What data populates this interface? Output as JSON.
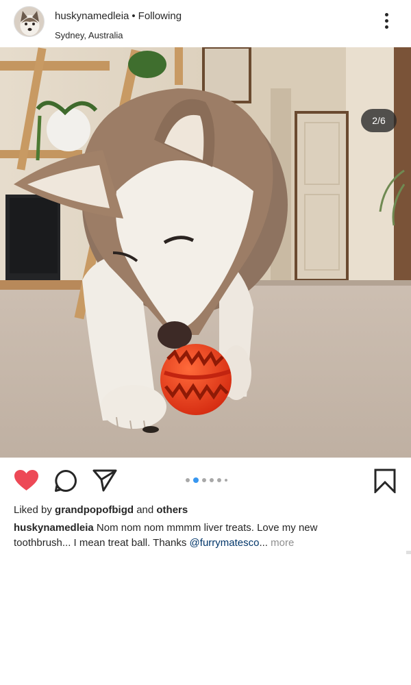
{
  "header": {
    "username": "huskynamedleia",
    "separator": "•",
    "follow_status": "Following",
    "location": "Sydney, Australia",
    "avatar_icon": "husky-avatar",
    "more_icon": "more-vertical-icon"
  },
  "photo": {
    "counter": "2/6",
    "current_index": 2,
    "total": 6
  },
  "actions": {
    "like_icon": "heart-filled-icon",
    "liked": true,
    "like_color": "#ed4956",
    "comment_icon": "comment-icon",
    "share_icon": "paper-plane-icon",
    "save_icon": "bookmark-icon",
    "active_dot_color": "#3897f0"
  },
  "likes": {
    "prefix": "Liked by",
    "user": "grandpopofbigd",
    "conjunction": "and",
    "others": "others"
  },
  "caption": {
    "username": "huskynamedleia",
    "text": "Nom nom nom mmmm liver treats. Love my new toothbrush... I mean treat ball. Thanks",
    "mention": "@furrymatesco",
    "ellipsis": "...",
    "more": "more"
  }
}
